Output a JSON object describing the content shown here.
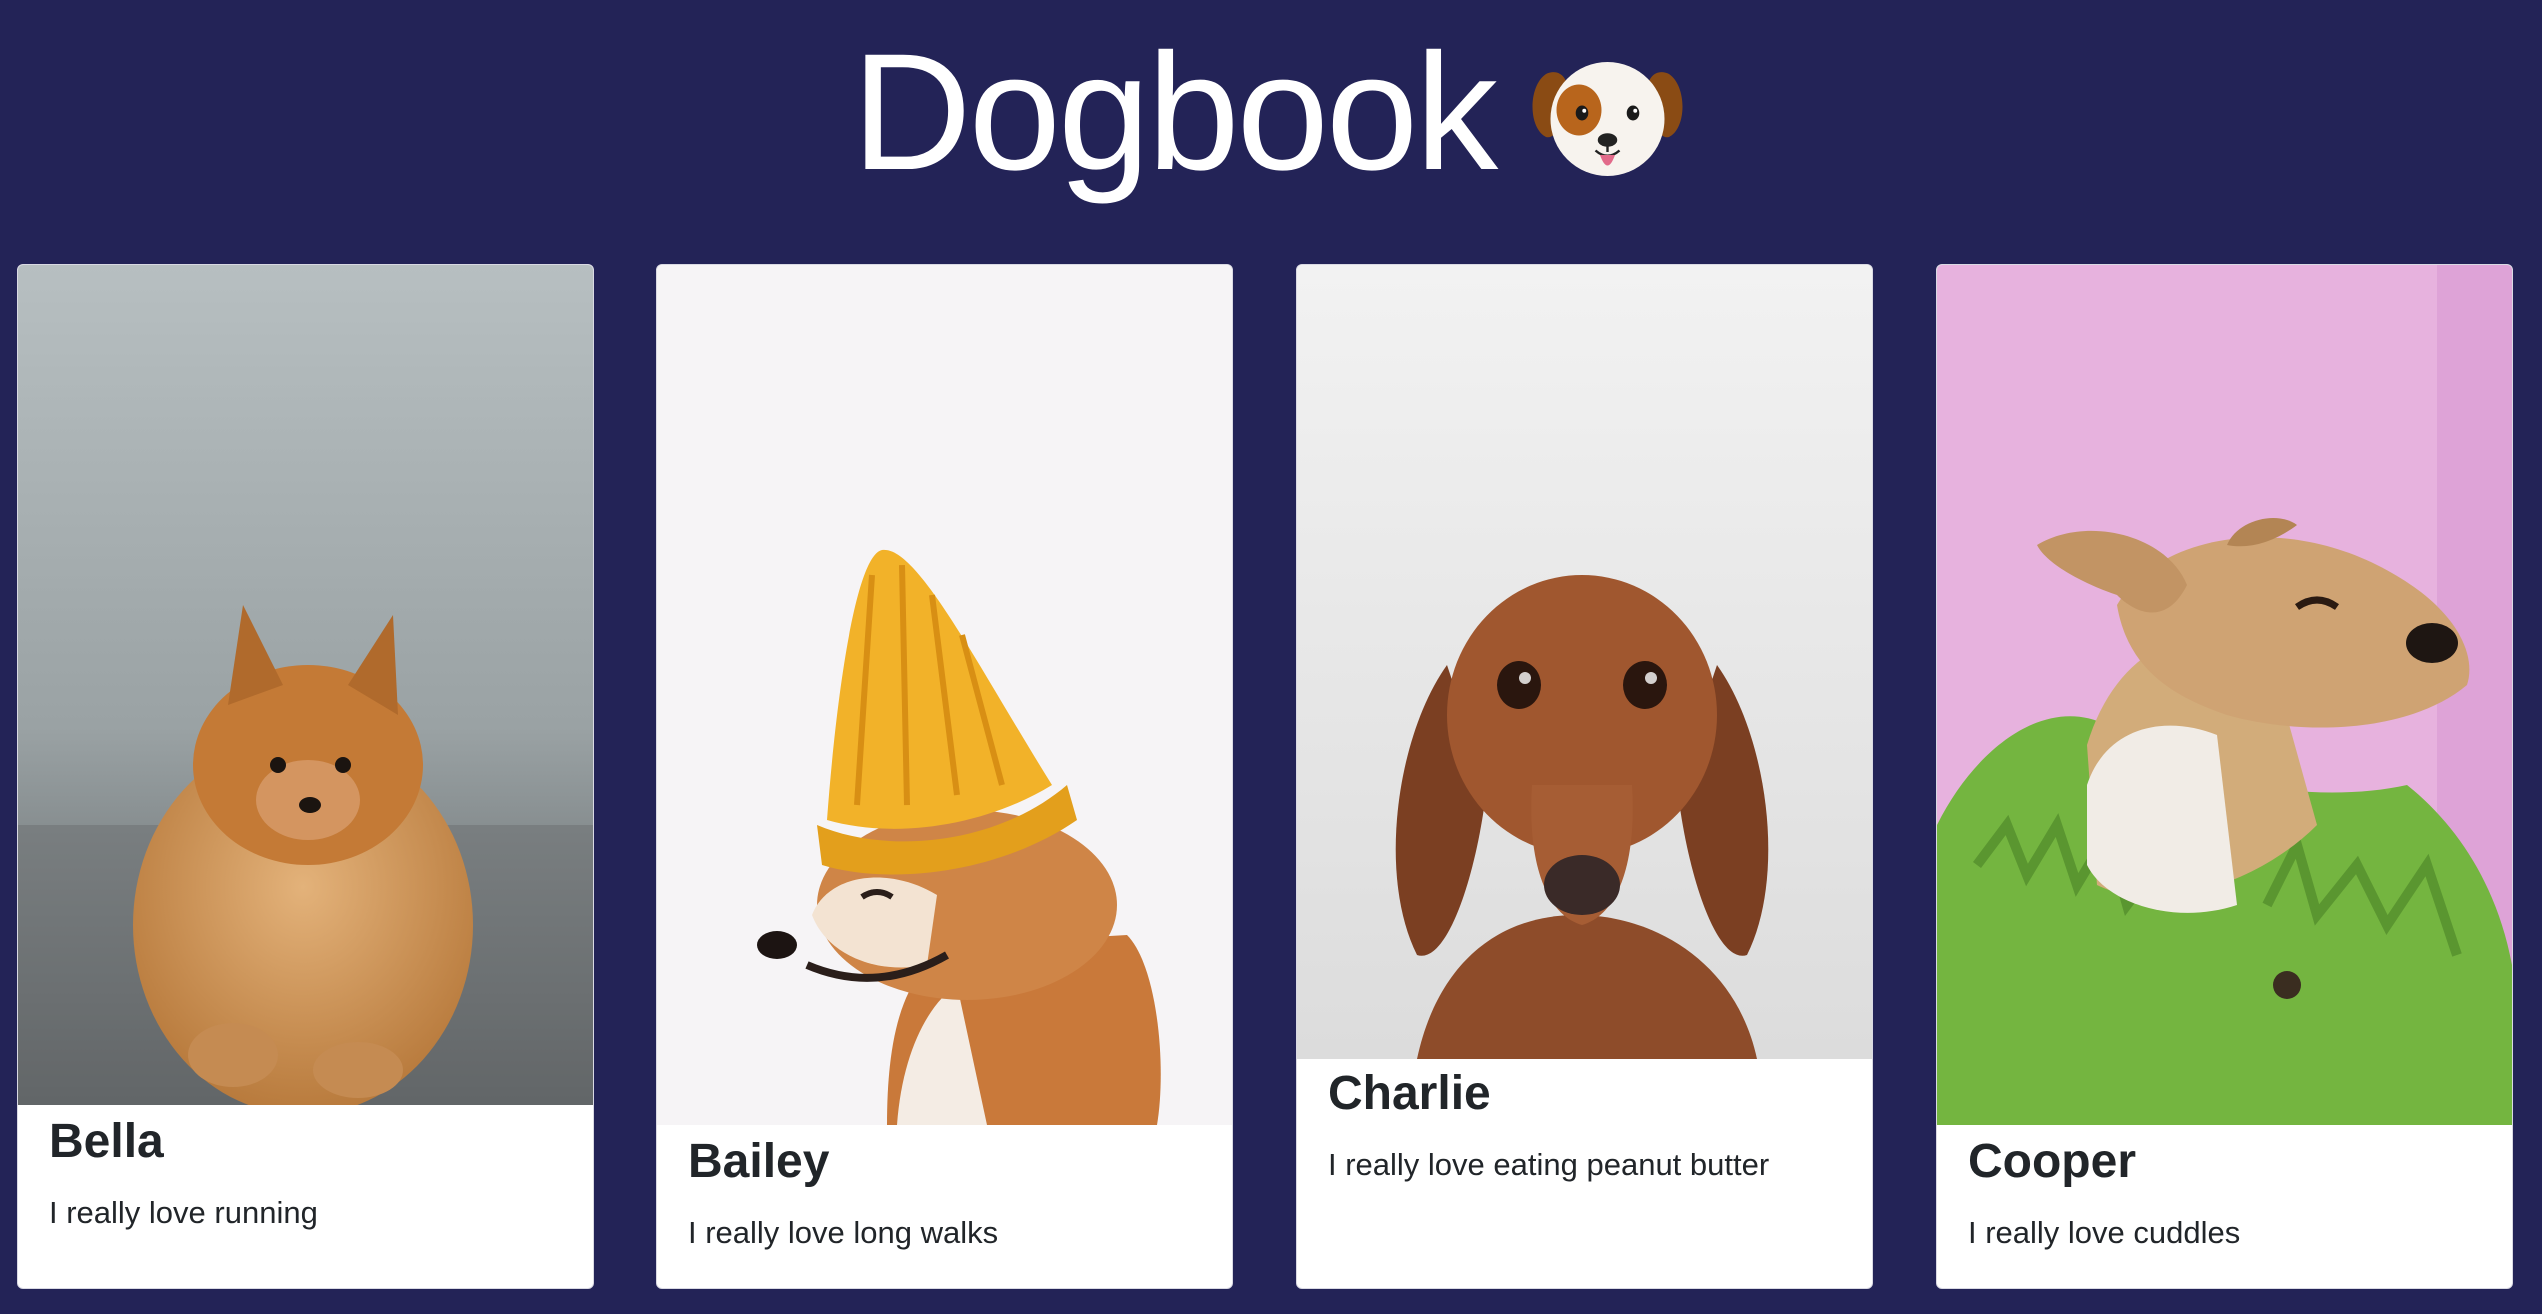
{
  "header": {
    "title": "Dogbook",
    "emoji": "dog-face-icon"
  },
  "cards": [
    {
      "name": "Bella",
      "description": "I really love running"
    },
    {
      "name": "Bailey",
      "description": "I really love long walks"
    },
    {
      "name": "Charlie",
      "description": "I really love eating peanut butter"
    },
    {
      "name": "Cooper",
      "description": "I really love cuddles"
    }
  ],
  "colors": {
    "page_background": "#232357",
    "card_background": "#ffffff",
    "title_text": "#ffffff",
    "card_text": "#212529"
  }
}
